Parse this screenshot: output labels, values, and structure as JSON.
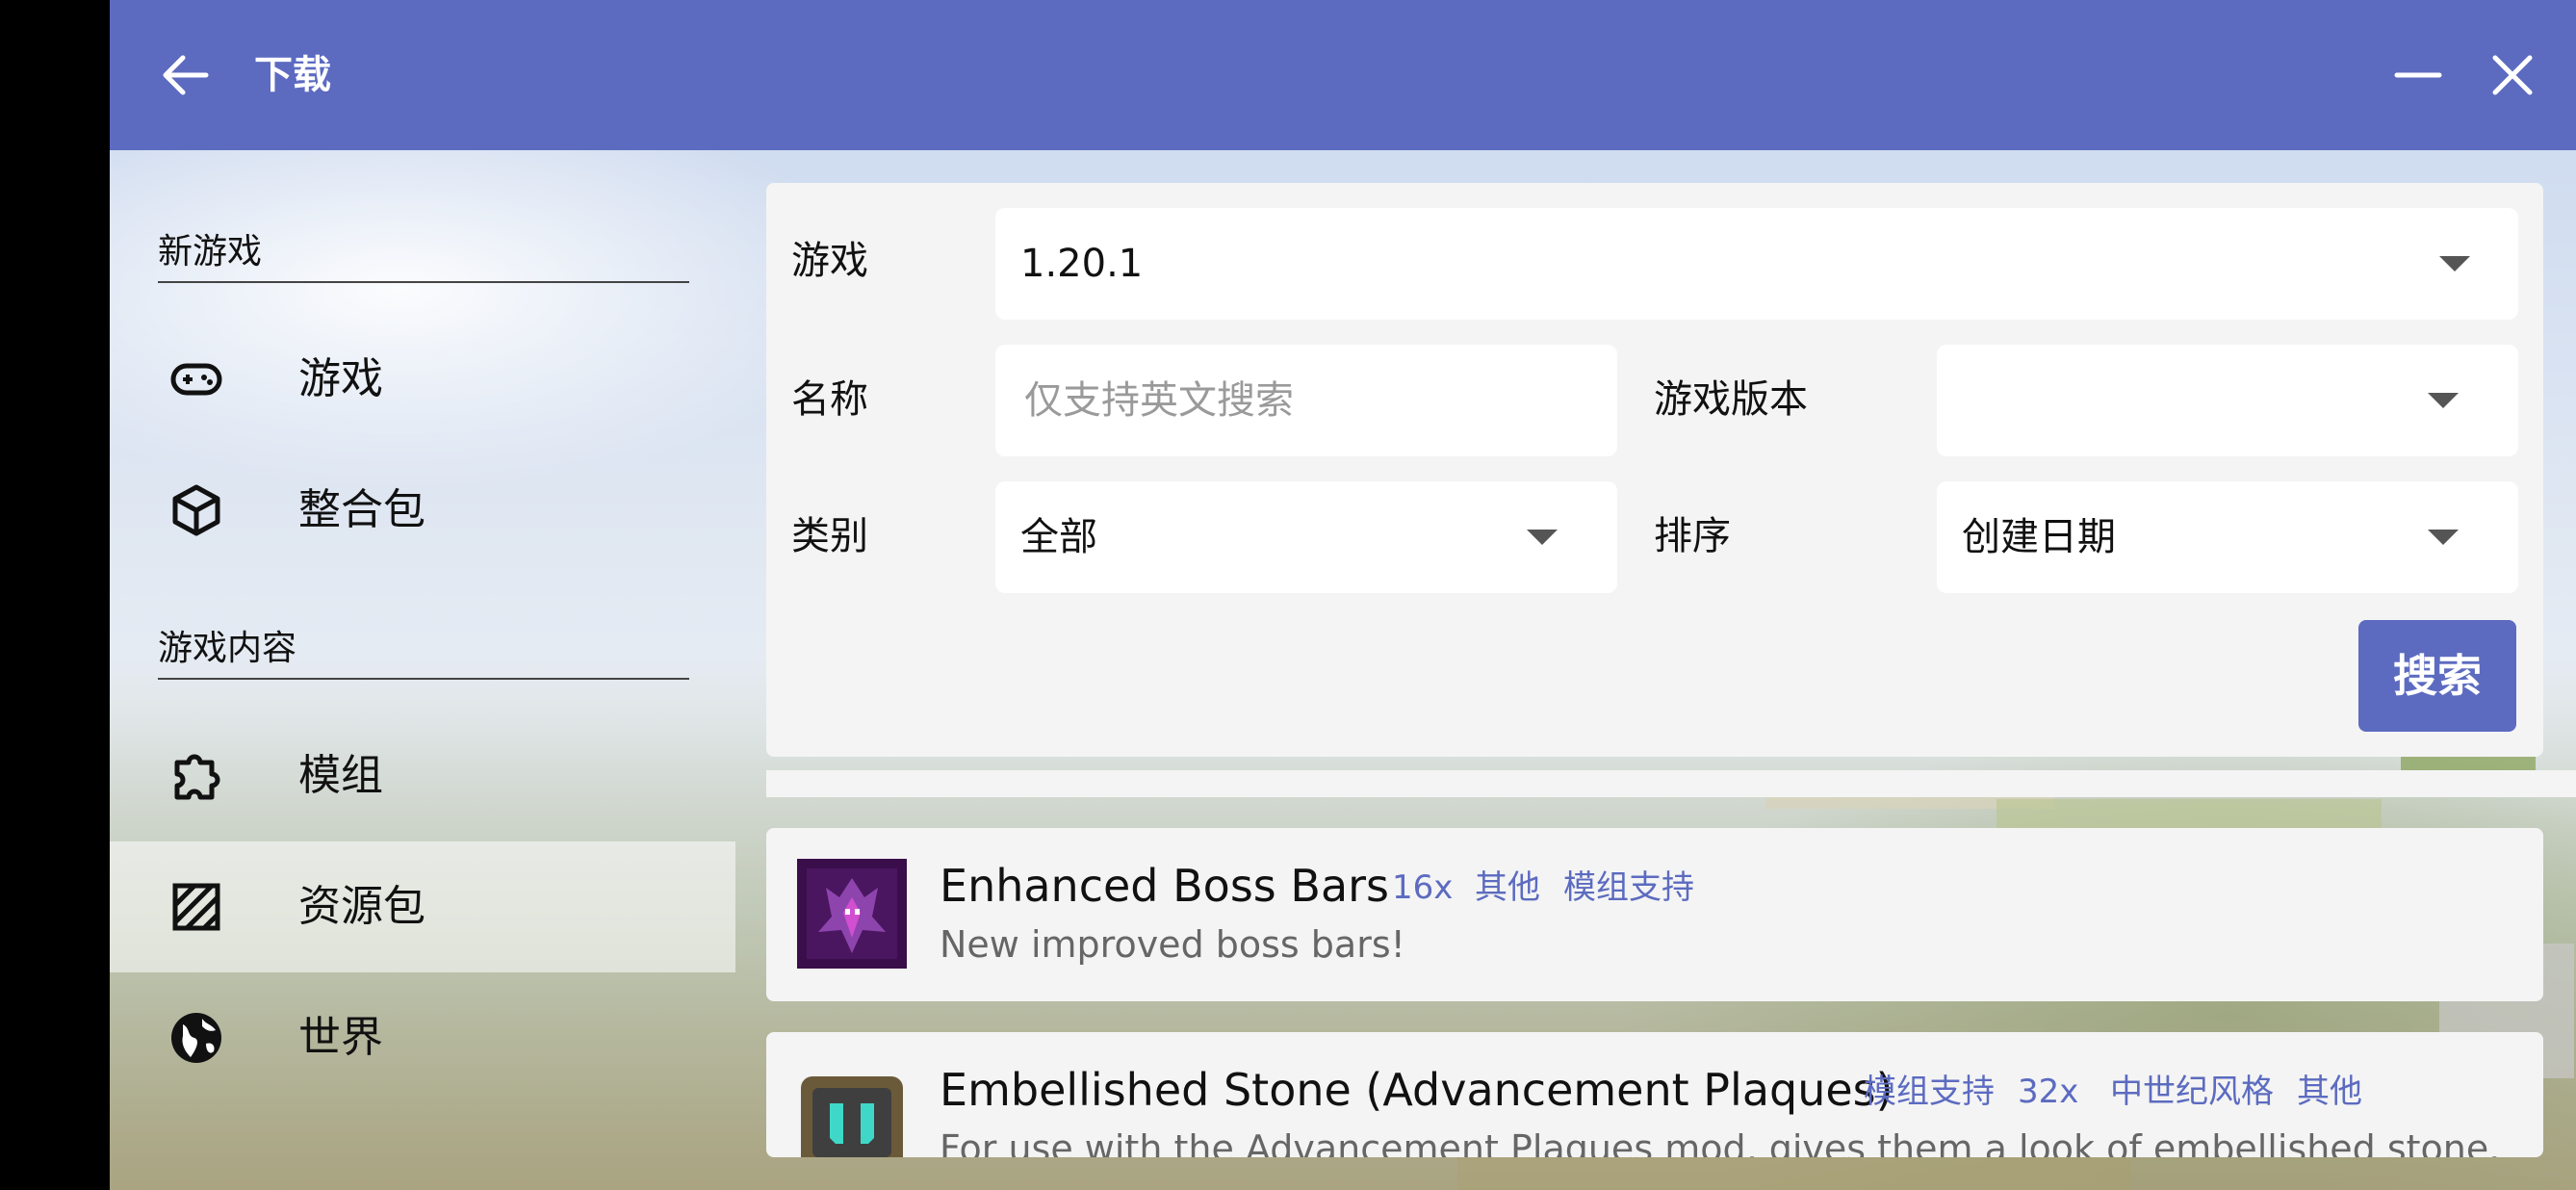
{
  "window": {
    "title": "下载"
  },
  "sidebar": {
    "sections": [
      {
        "title": "新游戏",
        "items": [
          {
            "label": "游戏",
            "icon": "gamepad-icon"
          },
          {
            "label": "整合包",
            "icon": "package-icon"
          }
        ]
      },
      {
        "title": "游戏内容",
        "items": [
          {
            "label": "模组",
            "icon": "puzzle-icon"
          },
          {
            "label": "资源包",
            "icon": "texture-icon",
            "selected": true
          },
          {
            "label": "世界",
            "icon": "globe-icon"
          }
        ]
      }
    ]
  },
  "filters": {
    "game": {
      "label": "游戏",
      "value": "1.20.1"
    },
    "name": {
      "label": "名称",
      "placeholder": "仅支持英文搜索",
      "value": ""
    },
    "game_version": {
      "label": "游戏版本",
      "value": ""
    },
    "category": {
      "label": "类别",
      "value": "全部"
    },
    "sort": {
      "label": "排序",
      "value": "创建日期"
    },
    "search_label": "搜索"
  },
  "results": [
    {
      "title": "Enhanced Boss Bars",
      "tags": [
        "16x",
        "其他",
        "模组支持"
      ],
      "description": "New improved boss bars!"
    },
    {
      "title": "Embellished Stone (Advancement Plaques)",
      "tags": [
        "模组支持",
        "32x",
        "中世纪风格",
        "其他"
      ],
      "description": "For use with the Advancement Plaques mod, gives them a look of embellished stone."
    }
  ],
  "colors": {
    "accent": "#5c6bc0",
    "panel": "#f4f4f4",
    "tag_text": "#5c6bc0"
  }
}
